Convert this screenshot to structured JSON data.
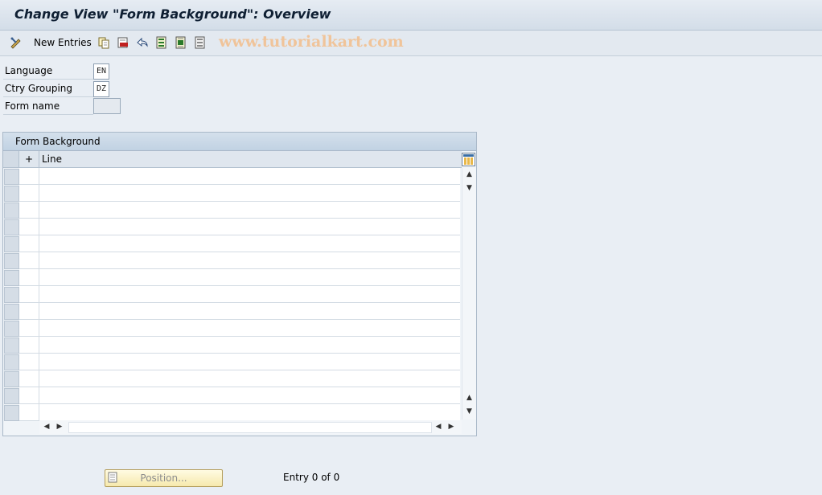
{
  "window": {
    "title": "Change View \"Form Background\": Overview"
  },
  "toolbar": {
    "new_entries_label": "New Entries",
    "icons": [
      "display-change-icon",
      "copy-icon",
      "delete-icon",
      "undo-icon",
      "select-all-icon",
      "select-block-icon",
      "deselect-all-icon"
    ],
    "watermark": "www.tutorialkart.com"
  },
  "fields": {
    "language": {
      "label": "Language",
      "value": "EN"
    },
    "ctry_grouping": {
      "label": "Ctry Grouping",
      "value": "DZ"
    },
    "form_name": {
      "label": "Form name",
      "value": ""
    }
  },
  "table": {
    "title": "Form Background",
    "columns": [
      "+",
      "Line"
    ],
    "rows": []
  },
  "footer": {
    "position_button": "Position...",
    "entry_text": "Entry 0 of 0"
  },
  "colors": {
    "accent": "#f0c49a",
    "titlebar": "#d3dde8",
    "button": "#f6e9ad"
  }
}
